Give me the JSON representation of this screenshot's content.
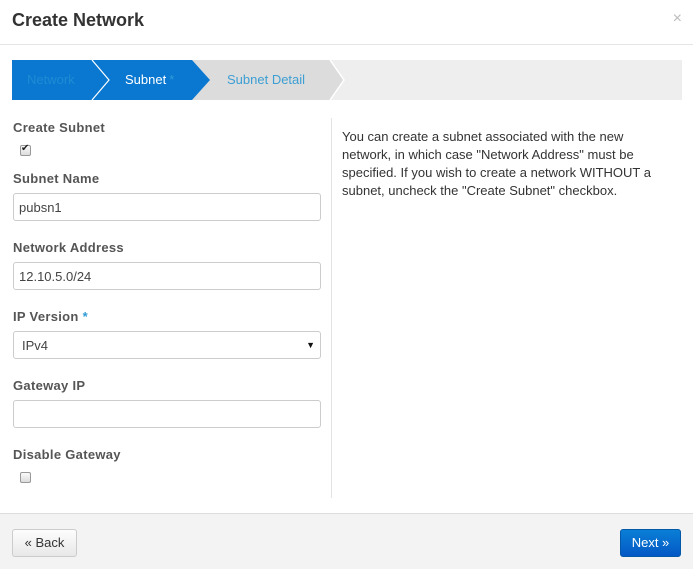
{
  "modal": {
    "title": "Create Network",
    "close_icon": "×"
  },
  "wizard": {
    "steps": [
      {
        "label": "Network",
        "state": "completed",
        "required": false
      },
      {
        "label": "Subnet",
        "state": "active",
        "required": true,
        "required_marker": "*"
      },
      {
        "label": "Subnet Detail",
        "state": "pending",
        "required": false
      }
    ],
    "colors": {
      "active": "#0a78d1",
      "pending": "#dcdcdc",
      "track": "#eeeeee"
    }
  },
  "form": {
    "create_subnet": {
      "label": "Create Subnet",
      "checked": true,
      "check_glyph": "✔"
    },
    "subnet_name": {
      "label": "Subnet Name",
      "value": "pubsn1",
      "placeholder": ""
    },
    "network_address": {
      "label": "Network Address",
      "value": "12.10.5.0/24",
      "placeholder": ""
    },
    "ip_version": {
      "label": "IP Version",
      "required_marker": "*",
      "selected": "IPv4",
      "caret": "▼"
    },
    "gateway_ip": {
      "label": "Gateway IP",
      "value": "",
      "placeholder": ""
    },
    "disable_gateway": {
      "label": "Disable Gateway",
      "checked": false
    }
  },
  "help": {
    "text": "You can create a subnet associated with the new network, in which case \"Network Address\" must be specified. If you wish to create a network WITHOUT a subnet, uncheck the \"Create Subnet\" checkbox."
  },
  "footer": {
    "back_label": "« Back",
    "next_label": "Next »"
  }
}
